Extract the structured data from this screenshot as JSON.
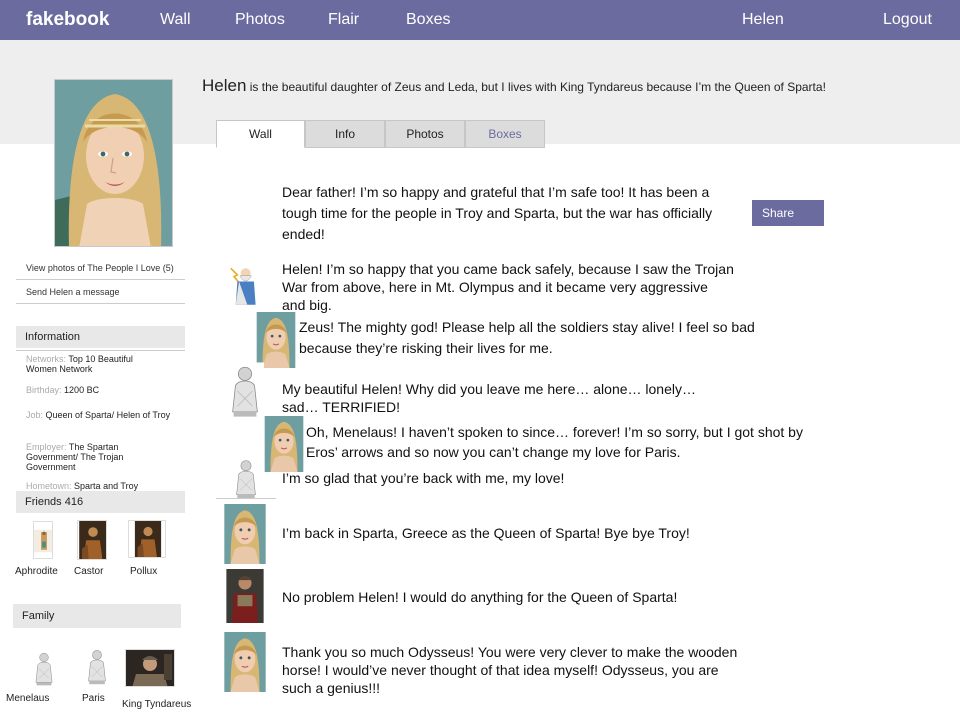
{
  "nav": {
    "logo": "fakebook",
    "links": [
      "Wall",
      "Photos",
      "Flair",
      "Boxes"
    ],
    "user": "Helen",
    "logout": "Logout"
  },
  "profile": {
    "name": "Helen",
    "bio": " is the beautiful daughter of Zeus and Leda, but I lives with King Tyndareus because I’m the Queen  of Sparta!"
  },
  "tabs": [
    "Wall",
    "Info",
    "Photos",
    "Boxes"
  ],
  "sidebar": {
    "view_photos": "View photos of The People  I Love (5)",
    "send_message": "Send Helen  a message",
    "information_header": "Information",
    "info": [
      {
        "key": "Networks:",
        "value": "Top 10 Beautiful Women Network"
      },
      {
        "key": "Birthday:",
        "value": "1200 BC"
      },
      {
        "key": "Job:",
        "value": "Queen of Sparta/ Helen of Troy"
      },
      {
        "key": "Employer:",
        "value": "The Spartan Government/ The Trojan Government"
      },
      {
        "key": "Hometown:",
        "value": "Sparta and Troy"
      }
    ],
    "friends_header": "Friends 416",
    "friends": [
      "Aphrodite",
      "Castor",
      "Pollux"
    ],
    "family_header": "Family",
    "family": [
      "Menelaus",
      "Paris",
      "King Tyndareus"
    ]
  },
  "wall": {
    "share_label": "Share",
    "posts": [
      "Dear father!  I’m so happy and grateful that I’m safe too!  It has been a tough time for the people in Troy and Sparta, but the war has officially ended!",
      "Helen!  I’m so happy that you came back safely, because I saw the Trojan War  from above, here in Mt.  Olympus and it became very aggressive and big.",
      "Zeus!  The mighty god!  Please help all the soldiers stay alive!  I feel so bad because they’re risking their lives for me.",
      "My beautiful Helen!  Why did you leave me here… alone… lonely… sad… TERRIFIED!",
      "Oh, Menelaus!  I haven’t spoken to since… forever!  I’m so sorry, but I got shot by Eros’ arrows and so now you can’t change my love for Paris.",
      "I’m so glad that you’re back with me, my love!",
      "I’m back in Sparta, Greece as the Queen of Sparta!  Bye bye Troy!",
      "No problem Helen!  I would do anything for the Queen of Sparta!",
      "Thank you so much Odysseus!  You were very clever to make the wooden horse!  I would’ve never thought of that idea myself!  Odysseus, you are such a genius!!!"
    ]
  }
}
